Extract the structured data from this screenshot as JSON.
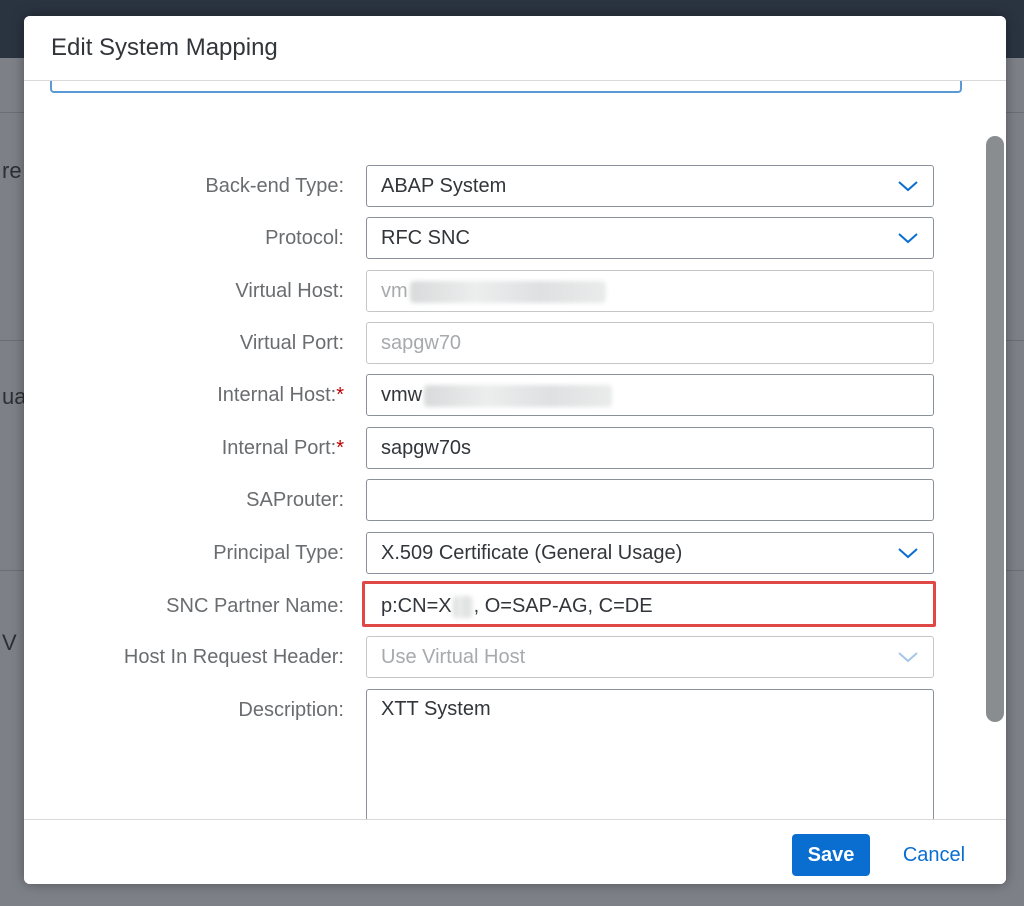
{
  "dialog": {
    "title": "Edit System Mapping"
  },
  "form": {
    "backend_type": {
      "label": "Back-end Type:",
      "value": "ABAP System"
    },
    "protocol": {
      "label": "Protocol:",
      "value": "RFC SNC"
    },
    "virtual_host": {
      "label": "Virtual Host:",
      "value": "vm"
    },
    "virtual_port": {
      "label": "Virtual Port:",
      "value": "sapgw70"
    },
    "internal_host": {
      "label": "Internal Host:",
      "required": "*",
      "value": "vmw"
    },
    "internal_port": {
      "label": "Internal Port:",
      "required": "*",
      "value": "sapgw70s"
    },
    "saprouter": {
      "label": "SAProuter:",
      "value": ""
    },
    "principal_type": {
      "label": "Principal Type:",
      "value": "X.509 Certificate (General Usage)"
    },
    "snc_partner_name": {
      "label": "SNC Partner Name:",
      "value_start": "p:CN=X",
      "value_end": ", O=SAP-AG, C=DE"
    },
    "host_in_request_header": {
      "label": "Host In Request Header:",
      "value": "Use Virtual Host"
    },
    "description": {
      "label": "Description:",
      "value": "XTT System"
    }
  },
  "footer": {
    "save_label": "Save",
    "cancel_label": "Cancel"
  },
  "colors": {
    "accent": "#0a6ed1",
    "required": "#bb0000",
    "highlight": "#e04848"
  }
}
